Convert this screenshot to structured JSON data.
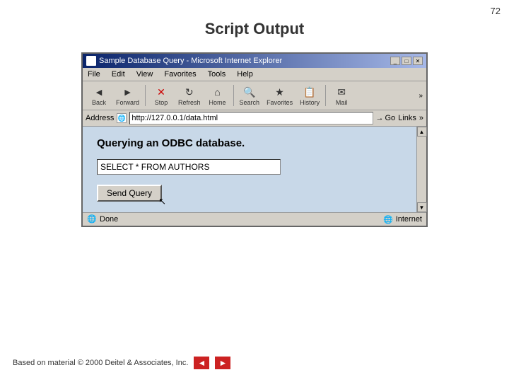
{
  "page": {
    "number": "72",
    "title": "Script Output"
  },
  "browser": {
    "title_bar": "Sample Database Query - Microsoft Internet Explorer",
    "menu": [
      "File",
      "Edit",
      "View",
      "Favorites",
      "Tools",
      "Help"
    ],
    "toolbar_buttons": [
      {
        "label": "Back",
        "icon": "◄"
      },
      {
        "label": "Forward",
        "icon": "►"
      },
      {
        "label": "Stop",
        "icon": "✕"
      },
      {
        "label": "Refresh",
        "icon": "↻"
      },
      {
        "label": "Home",
        "icon": "⌂"
      },
      {
        "label": "Search",
        "icon": "🔍"
      },
      {
        "label": "Favorites",
        "icon": "★"
      },
      {
        "label": "History",
        "icon": "📋"
      },
      {
        "label": "Mail",
        "icon": "✉"
      }
    ],
    "address_label": "Address",
    "address_url": "http://127.0.0.1/data.html",
    "go_label": "Go",
    "links_label": "Links",
    "content_heading": "Querying an ODBC database.",
    "query_value": "SELECT * FROM AUTHORS",
    "send_query_label": "Send Query",
    "status_text": "Done",
    "status_right": "Internet"
  },
  "footer": {
    "copyright": "Based on material © 2000 Deitel & Associates, Inc.",
    "prev_label": "◄",
    "next_label": "►"
  }
}
